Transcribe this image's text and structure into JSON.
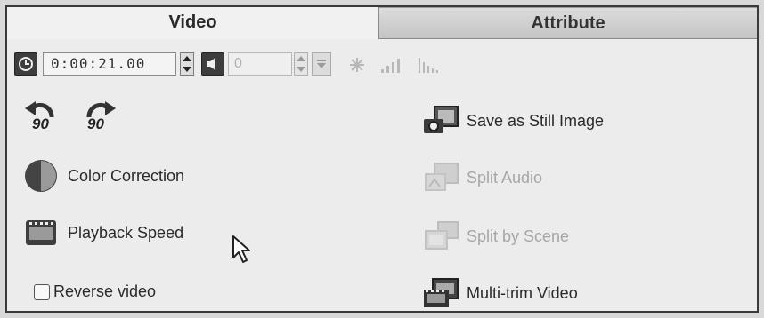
{
  "tabs": {
    "video": "Video",
    "attribute": "Attribute"
  },
  "toolbar": {
    "timecode": "0:00:21.00",
    "volume_value": "0",
    "icons": [
      "clock-icon",
      "speaker-icon",
      "spark-icon",
      "volume-bars-icon",
      "audio-level-icon"
    ]
  },
  "rotate": {
    "left_label": "90",
    "right_label": "90"
  },
  "left_actions": {
    "color_correction": "Color Correction",
    "playback_speed": "Playback Speed",
    "reverse_video": "Reverse video"
  },
  "right_actions": {
    "save_still": "Save as Still Image",
    "split_audio": "Split Audio",
    "split_scene": "Split by Scene",
    "multi_trim": "Multi-trim Video"
  },
  "colors": {
    "panel": "#ececec",
    "tab_active": "#f1f1f1",
    "tab_inactive": "#c8c8c8",
    "disabled_text": "#a6a6a6"
  }
}
